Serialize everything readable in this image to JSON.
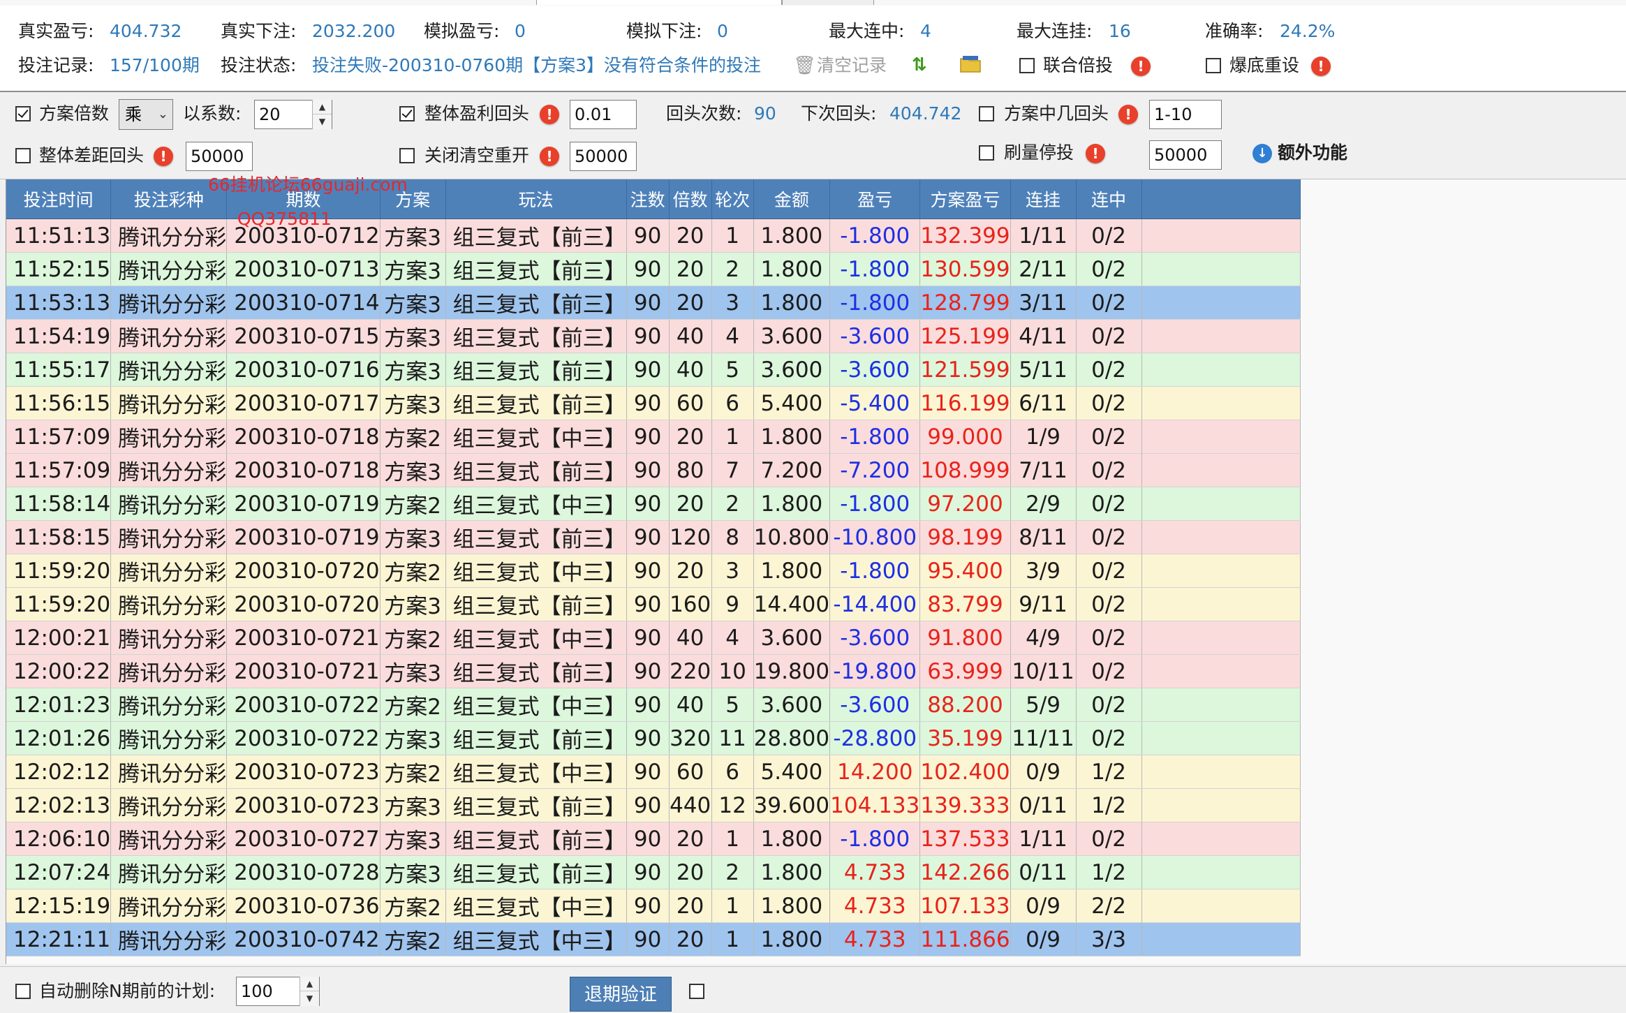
{
  "summary": {
    "real_pnl_label": "真实盈亏:",
    "real_pnl": "404.732",
    "real_bet_label": "真实下注:",
    "real_bet": "2032.200",
    "sim_pnl_label": "模拟盈亏:",
    "sim_pnl": "0",
    "sim_bet_label": "模拟下注:",
    "sim_bet": "0",
    "max_hit_label": "最大连中:",
    "max_hit": "4",
    "max_miss_label": "最大连挂:",
    "max_miss": "16",
    "accuracy_label": "准确率:",
    "accuracy": "24.2%",
    "records_label": "投注记录:",
    "records": "157/100期",
    "status_label": "投注状态:",
    "status": "投注失败-200310-0760期【方案3】没有符合条件的投注",
    "clear_label": "清空记录",
    "joint_multiple_label": "联合倍投",
    "bust_reset_label": "爆底重设"
  },
  "controls": {
    "plan_multiple_label": "方案倍数",
    "op_value": "乘",
    "coef_label": "以系数:",
    "coef_value": "20",
    "overall_profit_back_label": "整体盈利回头",
    "overall_profit_back_value": "0.01",
    "back_count_label": "回头次数:",
    "back_count": "90",
    "next_back_label": "下次回头:",
    "next_back": "404.742",
    "plan_hits_back_label": "方案中几回头",
    "plan_hits_back_value": "1-10",
    "overall_gap_back_label": "整体差距回头",
    "overall_gap_back_value": "50000",
    "close_clear_restart_label": "关闭清空重开",
    "close_clear_restart_value": "50000",
    "volume_stop_label": "刷量停投",
    "volume_stop_value": "50000",
    "extra_label": "额外功能"
  },
  "watermark": {
    "line1": "66挂机论坛66guaji.com",
    "line2": "QQ375811"
  },
  "table": {
    "headers": [
      "投注时间",
      "投注彩种",
      "期数",
      "方案",
      "玩法",
      "注数",
      "倍数",
      "轮次",
      "金额",
      "盈亏",
      "方案盈亏",
      "连挂",
      "连中"
    ],
    "rows": [
      [
        "11:51:13",
        "腾讯分分彩",
        "200310-0712",
        "方案3",
        "组三复式【前三】",
        "90",
        "20",
        "1",
        "1.800",
        "-1.800",
        "132.399",
        "1/11",
        "0/2"
      ],
      [
        "11:52:15",
        "腾讯分分彩",
        "200310-0713",
        "方案3",
        "组三复式【前三】",
        "90",
        "20",
        "2",
        "1.800",
        "-1.800",
        "130.599",
        "2/11",
        "0/2"
      ],
      [
        "11:53:13",
        "腾讯分分彩",
        "200310-0714",
        "方案3",
        "组三复式【前三】",
        "90",
        "20",
        "3",
        "1.800",
        "-1.800",
        "128.799",
        "3/11",
        "0/2"
      ],
      [
        "11:54:19",
        "腾讯分分彩",
        "200310-0715",
        "方案3",
        "组三复式【前三】",
        "90",
        "40",
        "4",
        "3.600",
        "-3.600",
        "125.199",
        "4/11",
        "0/2"
      ],
      [
        "11:55:17",
        "腾讯分分彩",
        "200310-0716",
        "方案3",
        "组三复式【前三】",
        "90",
        "40",
        "5",
        "3.600",
        "-3.600",
        "121.599",
        "5/11",
        "0/2"
      ],
      [
        "11:56:15",
        "腾讯分分彩",
        "200310-0717",
        "方案3",
        "组三复式【前三】",
        "90",
        "60",
        "6",
        "5.400",
        "-5.400",
        "116.199",
        "6/11",
        "0/2"
      ],
      [
        "11:57:09",
        "腾讯分分彩",
        "200310-0718",
        "方案2",
        "组三复式【中三】",
        "90",
        "20",
        "1",
        "1.800",
        "-1.800",
        "99.000",
        "1/9",
        "0/2"
      ],
      [
        "11:57:09",
        "腾讯分分彩",
        "200310-0718",
        "方案3",
        "组三复式【前三】",
        "90",
        "80",
        "7",
        "7.200",
        "-7.200",
        "108.999",
        "7/11",
        "0/2"
      ],
      [
        "11:58:14",
        "腾讯分分彩",
        "200310-0719",
        "方案2",
        "组三复式【中三】",
        "90",
        "20",
        "2",
        "1.800",
        "-1.800",
        "97.200",
        "2/9",
        "0/2"
      ],
      [
        "11:58:15",
        "腾讯分分彩",
        "200310-0719",
        "方案3",
        "组三复式【前三】",
        "90",
        "120",
        "8",
        "10.800",
        "-10.800",
        "98.199",
        "8/11",
        "0/2"
      ],
      [
        "11:59:20",
        "腾讯分分彩",
        "200310-0720",
        "方案2",
        "组三复式【中三】",
        "90",
        "20",
        "3",
        "1.800",
        "-1.800",
        "95.400",
        "3/9",
        "0/2"
      ],
      [
        "11:59:20",
        "腾讯分分彩",
        "200310-0720",
        "方案3",
        "组三复式【前三】",
        "90",
        "160",
        "9",
        "14.400",
        "-14.400",
        "83.799",
        "9/11",
        "0/2"
      ],
      [
        "12:00:21",
        "腾讯分分彩",
        "200310-0721",
        "方案2",
        "组三复式【中三】",
        "90",
        "40",
        "4",
        "3.600",
        "-3.600",
        "91.800",
        "4/9",
        "0/2"
      ],
      [
        "12:00:22",
        "腾讯分分彩",
        "200310-0721",
        "方案3",
        "组三复式【前三】",
        "90",
        "220",
        "10",
        "19.800",
        "-19.800",
        "63.999",
        "10/11",
        "0/2"
      ],
      [
        "12:01:23",
        "腾讯分分彩",
        "200310-0722",
        "方案2",
        "组三复式【中三】",
        "90",
        "40",
        "5",
        "3.600",
        "-3.600",
        "88.200",
        "5/9",
        "0/2"
      ],
      [
        "12:01:26",
        "腾讯分分彩",
        "200310-0722",
        "方案3",
        "组三复式【前三】",
        "90",
        "320",
        "11",
        "28.800",
        "-28.800",
        "35.199",
        "11/11",
        "0/2"
      ],
      [
        "12:02:12",
        "腾讯分分彩",
        "200310-0723",
        "方案2",
        "组三复式【中三】",
        "90",
        "60",
        "6",
        "5.400",
        "14.200",
        "102.400",
        "0/9",
        "1/2"
      ],
      [
        "12:02:13",
        "腾讯分分彩",
        "200310-0723",
        "方案3",
        "组三复式【前三】",
        "90",
        "440",
        "12",
        "39.600",
        "104.133",
        "139.333",
        "0/11",
        "1/2"
      ],
      [
        "12:06:10",
        "腾讯分分彩",
        "200310-0727",
        "方案3",
        "组三复式【前三】",
        "90",
        "20",
        "1",
        "1.800",
        "-1.800",
        "137.533",
        "1/11",
        "0/2"
      ],
      [
        "12:07:24",
        "腾讯分分彩",
        "200310-0728",
        "方案3",
        "组三复式【前三】",
        "90",
        "20",
        "2",
        "1.800",
        "4.733",
        "142.266",
        "0/11",
        "1/2"
      ],
      [
        "12:15:19",
        "腾讯分分彩",
        "200310-0736",
        "方案2",
        "组三复式【中三】",
        "90",
        "20",
        "1",
        "1.800",
        "4.733",
        "107.133",
        "0/9",
        "2/2"
      ],
      [
        "12:21:11",
        "腾讯分分彩",
        "200310-0742",
        "方案2",
        "组三复式【中三】",
        "90",
        "20",
        "1",
        "1.800",
        "4.733",
        "111.866",
        "0/9",
        "3/3"
      ]
    ],
    "row_colors": [
      "pink",
      "green",
      "selected",
      "pink",
      "green",
      "yellow",
      "pink",
      "pink",
      "green",
      "pink",
      "yellow",
      "yellow",
      "pink",
      "pink",
      "green",
      "green",
      "yellow",
      "yellow",
      "pink",
      "green",
      "yellow",
      "selected"
    ]
  },
  "bottom": {
    "auto_delete_label": "自动删除N期前的计划:",
    "auto_delete_value": "100",
    "verify_button": "退期验证"
  },
  "colors": {
    "header_bg": "#4f81b9",
    "value_blue": "#2e79b9",
    "loss_blue": "#1d2fe3",
    "profit_red": "#e8231a",
    "selected_row": "#9fc4ee"
  },
  "icons": {
    "clear": "trash-icon",
    "sort": "sort-arrows-icon",
    "folder": "folder-icon",
    "warn": "warning-icon",
    "info": "info-icon"
  }
}
